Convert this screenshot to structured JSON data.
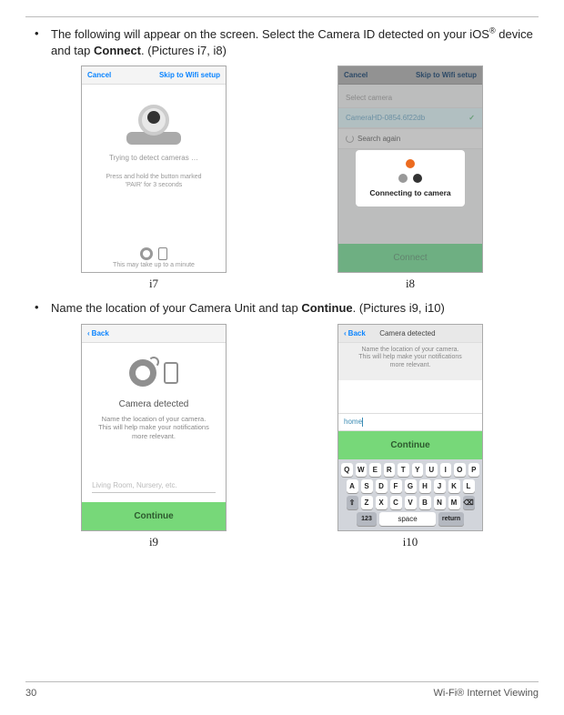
{
  "bullets": {
    "b1_pre": "The following will appear on the screen. Select the Camera ID detected on your iOS",
    "b1_post": " device and tap ",
    "b1_bold": "Connect",
    "b1_tail": ". (Pictures i7, i8)",
    "b2_pre": "Name the location of your Camera Unit and tap ",
    "b2_bold": "Continue",
    "b2_tail": ". (Pictures i9, i10)"
  },
  "captions": {
    "i7": "i7",
    "i8": "i8",
    "i9": "i9",
    "i10": "i10"
  },
  "i7": {
    "nav_left": "Cancel",
    "nav_right": "Skip to Wifi setup",
    "line1": "Trying to detect cameras …",
    "line2a": "Press and hold the button marked",
    "line2b": "'PAIR' for 3 seconds",
    "footer": "This may take up to a minute"
  },
  "i8": {
    "nav_left": "Cancel",
    "nav_right": "Skip to Wifi setup",
    "label": "Select camera",
    "row_sel": "CameraHD-0854.6f22db",
    "row2": "Search again",
    "overlay": "Connecting to camera",
    "connect": "Connect"
  },
  "i9": {
    "back": "Back",
    "heading": "Camera detected",
    "sub1": "Name the location of your camera.",
    "sub2": "This will help make your notifications",
    "sub3": "more relevant.",
    "placeholder": "Living Room, Nursery, etc.",
    "continue": "Continue"
  },
  "i10": {
    "back": "Back",
    "title": "Camera detected",
    "sub1": "Name the location of your camera.",
    "sub2": "This will help make your notifications",
    "sub3": "more relevant.",
    "input_value": "home",
    "continue": "Continue",
    "kb": {
      "r1": [
        "Q",
        "W",
        "E",
        "R",
        "T",
        "Y",
        "U",
        "I",
        "O",
        "P"
      ],
      "r2": [
        "A",
        "S",
        "D",
        "F",
        "G",
        "H",
        "J",
        "K",
        "L"
      ],
      "r3": [
        "Z",
        "X",
        "C",
        "V",
        "B",
        "N",
        "M"
      ],
      "shift": "⇧",
      "del": "⌫",
      "num": "123",
      "space": "space",
      "ret": "return"
    }
  },
  "footer": {
    "page": "30",
    "section": "Wi-Fi® Internet Viewing"
  }
}
